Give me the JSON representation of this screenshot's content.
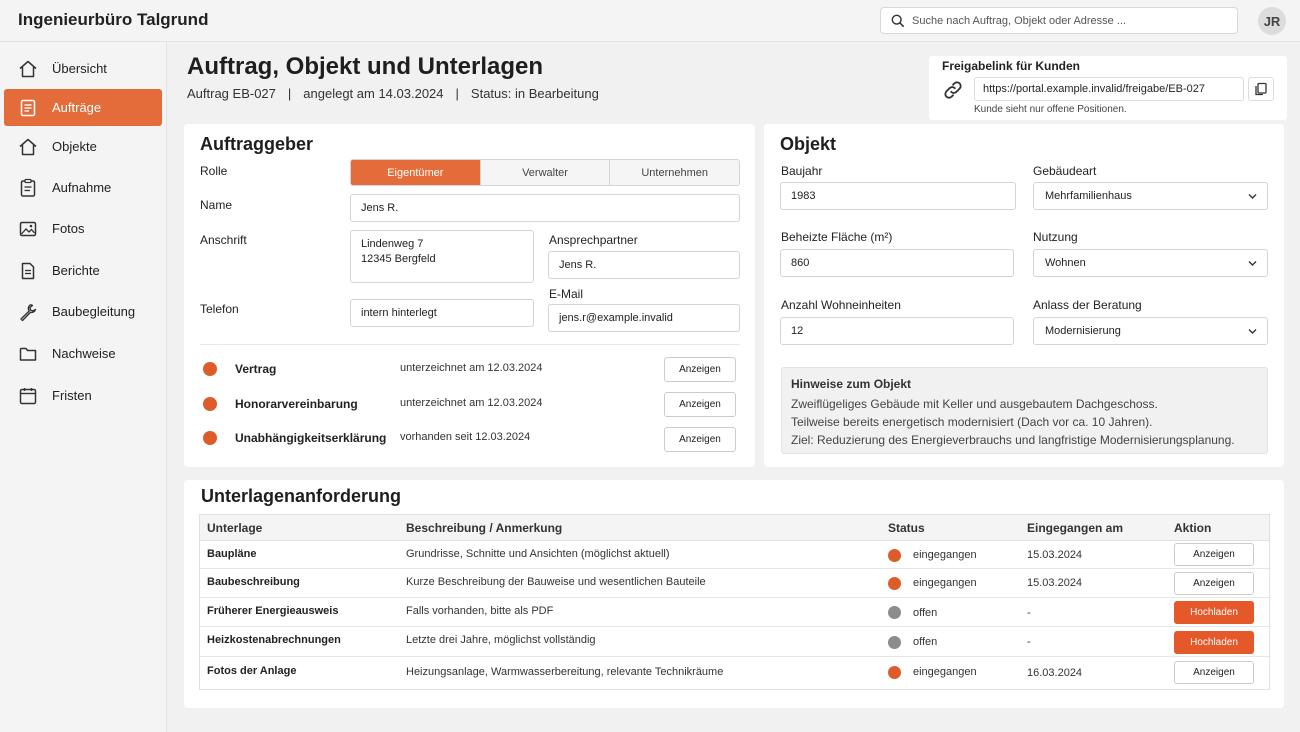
{
  "app": {
    "title": "Ingenieurbüro Talgrund"
  },
  "search": {
    "placeholder": "Suche nach Auftrag, Objekt oder Adresse ..."
  },
  "user": {
    "initials": "JR"
  },
  "nav": [
    {
      "label": "Übersicht",
      "icon": "home-icon"
    },
    {
      "label": "Aufträge",
      "icon": "clipboard-icon",
      "active": true
    },
    {
      "label": "Objekte",
      "icon": "building-icon"
    },
    {
      "label": "Aufnahme",
      "icon": "clipboard-check-icon"
    },
    {
      "label": "Fotos",
      "icon": "image-icon"
    },
    {
      "label": "Berichte",
      "icon": "document-icon"
    },
    {
      "label": "Baubegleitung",
      "icon": "wrench-icon"
    },
    {
      "label": "Nachweise",
      "icon": "folder-icon"
    },
    {
      "label": "Fristen",
      "icon": "calendar-icon"
    }
  ],
  "header": {
    "title": "Auftrag, Objekt und Unterlagen",
    "order": "Auftrag EB-027",
    "created": "angelegt am 14.03.2024",
    "status": "Status: in Bearbeitung",
    "sep": "|"
  },
  "share": {
    "title": "Freigabelink für Kunden",
    "url": "https://portal.example.invalid/freigabe/EB-027",
    "hint": "Kunde sieht nur offene Positionen."
  },
  "client": {
    "title": "Auftraggeber",
    "role_label": "Rolle",
    "roles": [
      "Eigentümer",
      "Verwalter",
      "Unternehmen"
    ],
    "active_role": 0,
    "name_label": "Name",
    "name": "Jens R.",
    "address_label": "Anschrift",
    "address": "Lindenweg 7\n12345 Bergfeld",
    "contact_label": "Ansprechpartner",
    "contact": "Jens R.",
    "phone_label": "Telefon",
    "phone": "intern hinterlegt",
    "email_label": "E-Mail",
    "email": "jens.r@example.invalid",
    "documents": [
      {
        "name": "Vertrag",
        "status": "unterzeichnet am 12.03.2024",
        "action": "Anzeigen"
      },
      {
        "name": "Honorarvereinbarung",
        "status": "unterzeichnet am 12.03.2024",
        "action": "Anzeigen"
      },
      {
        "name": "Unabhängigkeitserklärung",
        "status": "vorhanden seit 12.03.2024",
        "action": "Anzeigen"
      }
    ]
  },
  "object": {
    "title": "Objekt",
    "year_label": "Baujahr",
    "year": "1983",
    "type_label": "Gebäudeart",
    "type": "Mehrfamilienhaus",
    "area_label": "Beheizte Fläche (m²)",
    "area": "860",
    "usage_label": "Nutzung",
    "usage": "Wohnen",
    "units_label": "Anzahl Wohneinheiten",
    "units": "12",
    "reason_label": "Anlass der Beratung",
    "reason": "Modernisierung",
    "notes_title": "Hinweise zum Objekt",
    "notes": [
      "Zweiflügeliges Gebäude mit Keller und ausgebautem Dachgeschoss.",
      "Teilweise bereits energetisch modernisiert (Dach vor ca. 10 Jahren).",
      "Ziel: Reduzierung des Energieverbrauchs und langfristige Modernisierungsplanung."
    ]
  },
  "requests": {
    "title": "Unterlagenanforderung",
    "columns": [
      "Unterlage",
      "Beschreibung / Anmerkung",
      "Status",
      "Eingegangen am",
      "Aktion"
    ],
    "rows": [
      {
        "doc": "Baupläne",
        "desc": "Grundrisse, Schnitte und Ansichten (möglichst aktuell)",
        "status": "eingegangen",
        "date": "15.03.2024",
        "action": "Anzeigen"
      },
      {
        "doc": "Baubeschreibung",
        "desc": "Kurze Beschreibung der Bauweise und wesentlichen Bauteile",
        "status": "eingegangen",
        "date": "15.03.2024",
        "action": "Anzeigen"
      },
      {
        "doc": "Früherer Energieausweis",
        "desc": "Falls vorhanden, bitte als PDF",
        "status": "offen",
        "date": "-",
        "action": "Hochladen"
      },
      {
        "doc": "Heizkostenabrechnungen",
        "desc": "Letzte drei Jahre, möglichst vollständig",
        "status": "offen",
        "date": "-",
        "action": "Hochladen"
      },
      {
        "doc": "Fotos der Anlage",
        "desc": "Heizungsanlage, Warmwasserbereitung, relevante Technikräume",
        "status": "eingegangen",
        "date": "16.03.2024",
        "action": "Anzeigen"
      }
    ]
  },
  "colors": {
    "accent": "#e46c3b",
    "received": "#dd5c2a",
    "open": "#8c8c8c"
  }
}
